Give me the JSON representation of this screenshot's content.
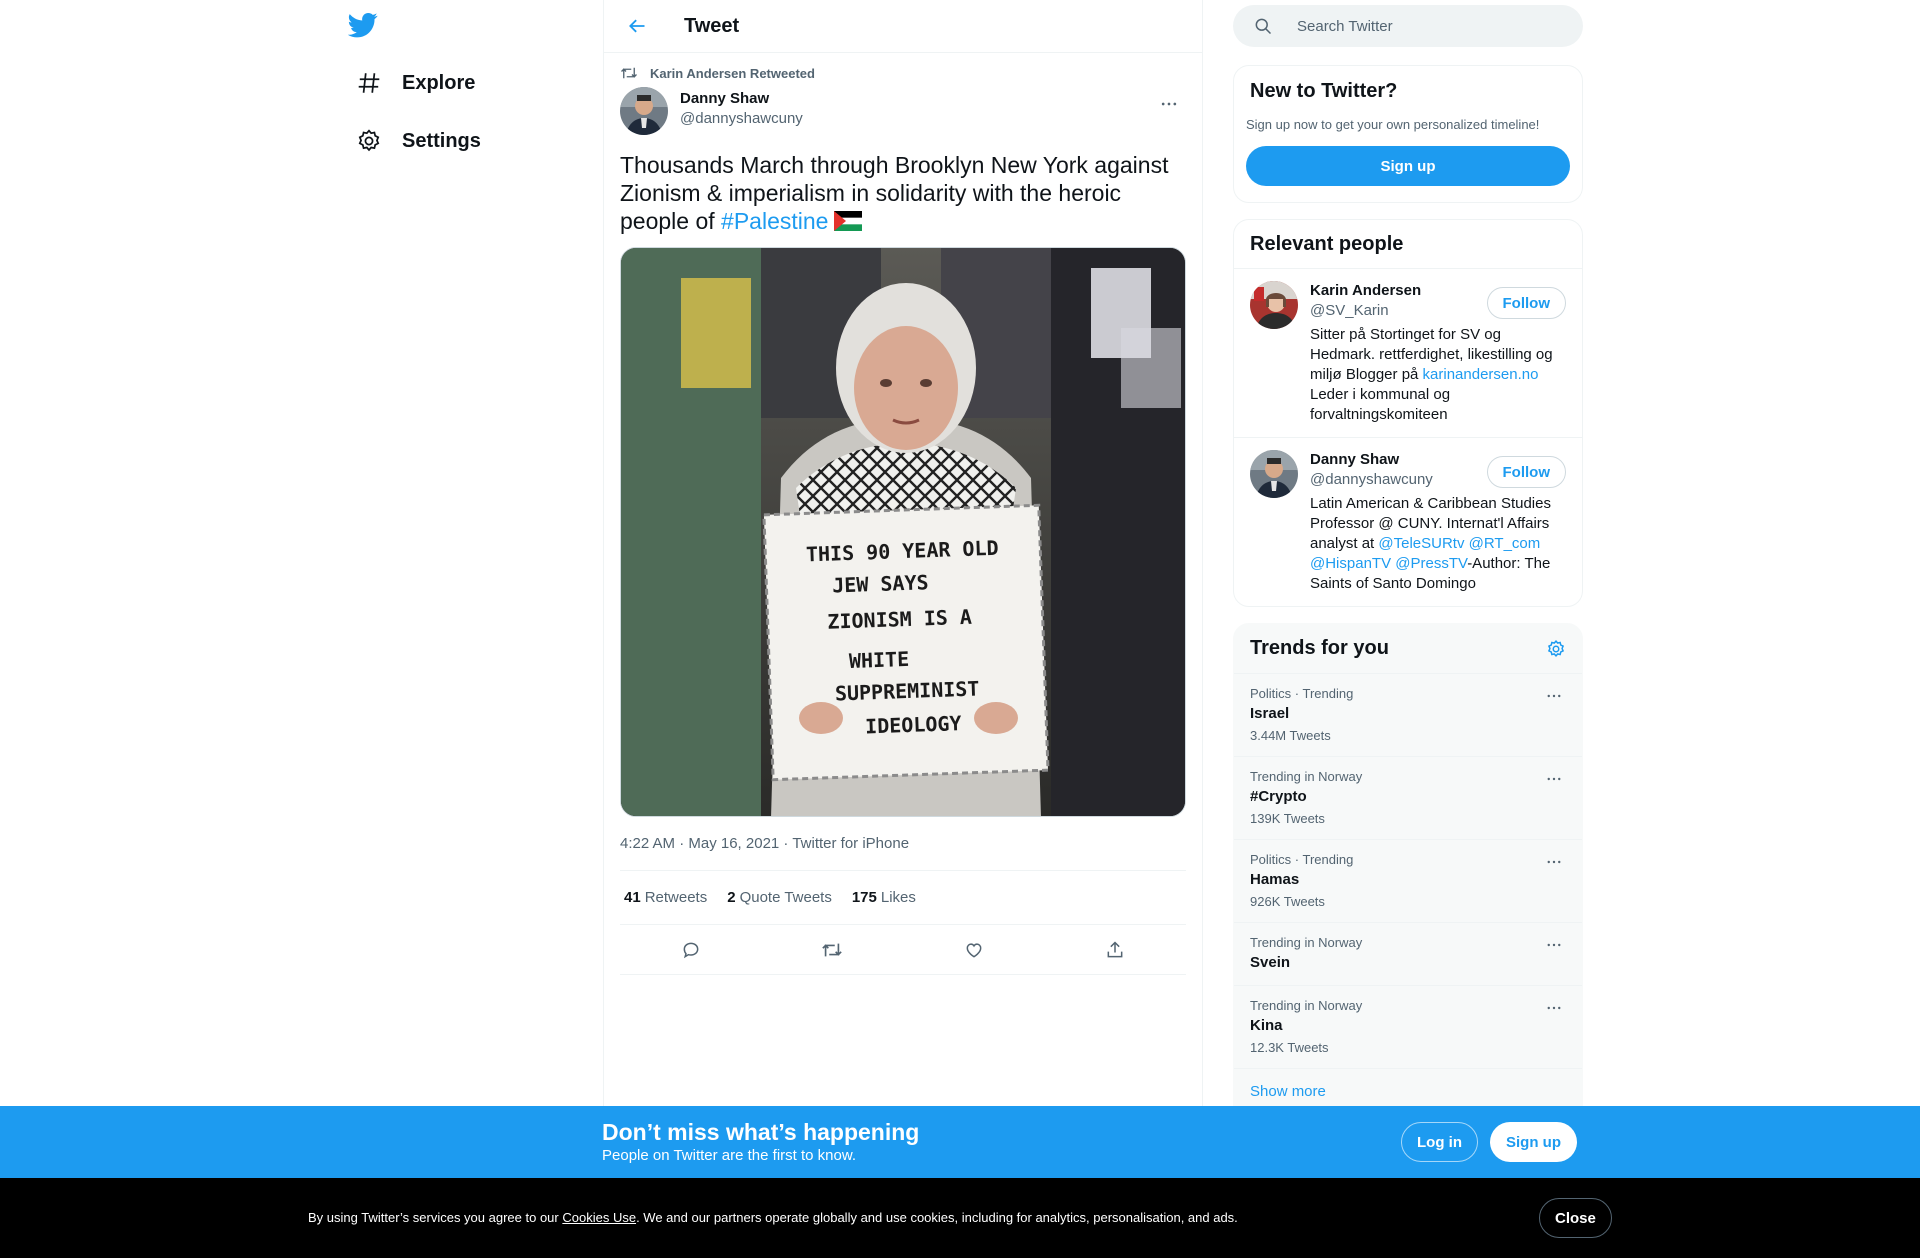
{
  "nav": {
    "explore_label": "Explore",
    "settings_label": "Settings"
  },
  "header": {
    "title": "Tweet"
  },
  "tweet": {
    "retweeted_by": "Karin Andersen Retweeted",
    "author_name": "Danny Shaw",
    "author_handle": "@dannyshawcuny",
    "text_before": "Thousands March through Brooklyn New York against Zionism & imperialism in solidarity with the heroic people of ",
    "hashtag": "#Palestine",
    "image_sign_lines": [
      "THIS 90 YEAR OLD",
      "JEW SAYS",
      "ZIONISM IS A",
      "WHITE",
      "SUPPREMINIST",
      "IDEOLOGY"
    ],
    "meta": "4:22 AM · May 16, 2021 · Twitter for iPhone",
    "stats": [
      {
        "count": "41",
        "label": "Retweets"
      },
      {
        "count": "2",
        "label": "Quote Tweets"
      },
      {
        "count": "175",
        "label": "Likes"
      }
    ]
  },
  "search": {
    "placeholder": "Search Twitter"
  },
  "signup_card": {
    "title": "New to Twitter?",
    "subtitle": "Sign up now to get your own personalized timeline!",
    "button": "Sign up"
  },
  "relevant_people": {
    "title": "Relevant people",
    "people": [
      {
        "name": "Karin Andersen",
        "handle": "@SV_Karin",
        "follow": "Follow",
        "bio_1": "Sitter på Stortinget for SV og Hedmark. rettferdighet, likestilling og miljø Blogger på ",
        "bio_link": "karinandersen.no",
        "bio_2": " Leder i kommunal og forvaltningskomiteen"
      },
      {
        "name": "Danny Shaw",
        "handle": "@dannyshawcuny",
        "follow": "Follow",
        "bio_1": "Latin American & Caribbean Studies Professor @ CUNY. Internat'l Affairs analyst at ",
        "mentions": [
          "@TeleSURtv",
          "@RT_com",
          "@HispanTV",
          "@PressTV"
        ],
        "bio_2": "-Author: The Saints of Santo Domingo"
      }
    ]
  },
  "trends": {
    "title": "Trends for you",
    "items": [
      {
        "context": "Politics · Trending",
        "name": "Israel",
        "count": "3.44M Tweets"
      },
      {
        "context": "Trending in Norway",
        "name": "#Crypto",
        "count": "139K Tweets"
      },
      {
        "context": "Politics · Trending",
        "name": "Hamas",
        "count": "926K Tweets"
      },
      {
        "context": "Trending in Norway",
        "name": "Svein",
        "count": ""
      },
      {
        "context": "Trending in Norway",
        "name": "Kina",
        "count": "12.3K Tweets"
      }
    ],
    "show_more": "Show more"
  },
  "bottom_bar": {
    "title": "Don’t miss what’s happening",
    "subtitle": "People on Twitter are the first to know.",
    "login": "Log in",
    "signup": "Sign up"
  },
  "cookie": {
    "text_1": "By using Twitter’s services you agree to our ",
    "link": "Cookies Use",
    "text_2": ". We and our partners operate globally and use cookies, including for analytics, personalisation, and ads.",
    "close": "Close"
  },
  "colors": {
    "accent": "#1d9bf0",
    "text": "#0f1419",
    "secondary": "#536471"
  }
}
